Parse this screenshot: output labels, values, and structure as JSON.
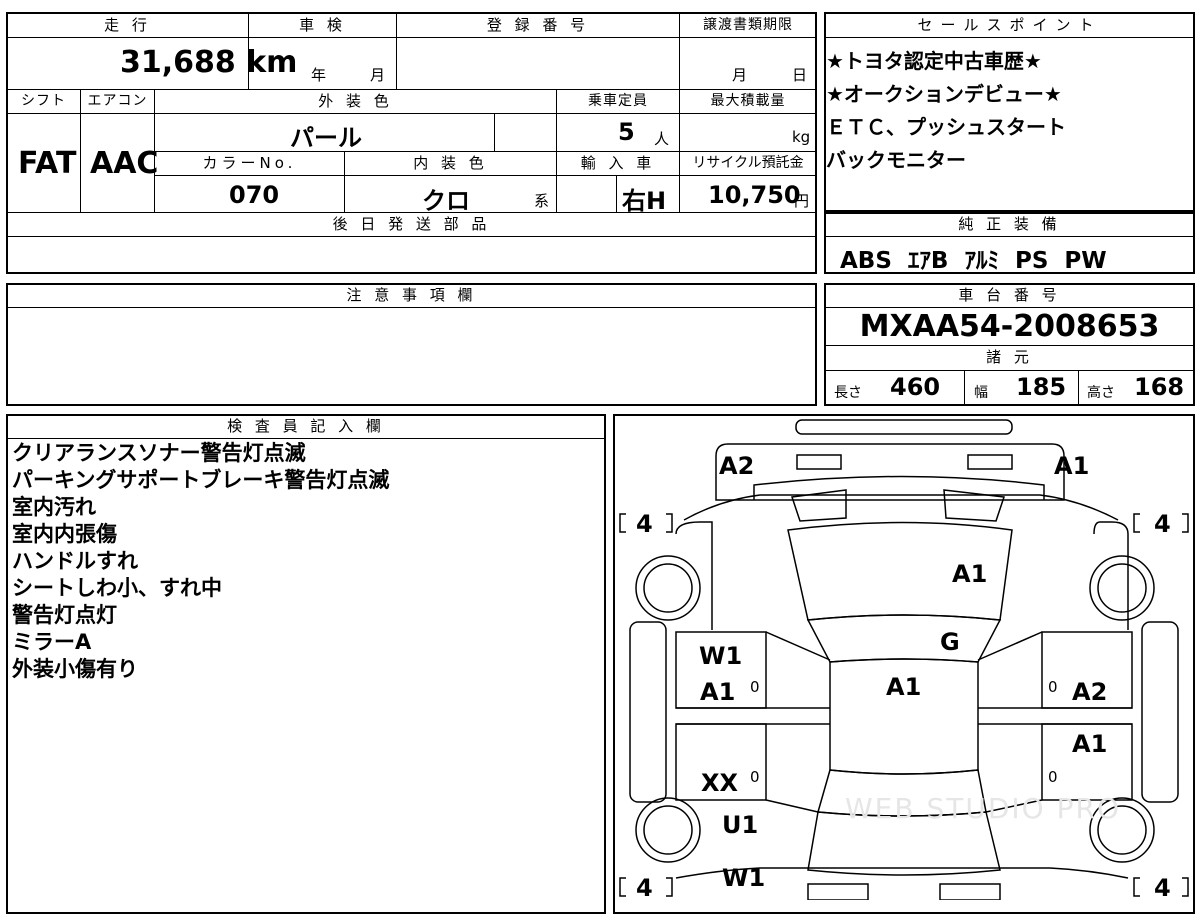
{
  "headers": {
    "mileage": "走 行",
    "inspection": "車 検",
    "registration": "登 録 番 号",
    "transfer_deadline": "譲渡書類期限",
    "sales_point": "セールスポイント",
    "shift": "シフト",
    "aircon": "エアコン",
    "exterior_color": "外 装 色",
    "capacity": "乗車定員",
    "max_load": "最大積載量",
    "color_no": "カラーNo.",
    "interior_color": "内 装 色",
    "import": "輸 入 車",
    "recycle_fee": "リサイクル預託金",
    "later_parts": "後 日 発 送 部 品",
    "standard_equipment": "純 正 装 備",
    "notes": "注 意 事 項 欄",
    "chassis_no": "車 台 番 号",
    "specs": "諸 元",
    "inspector_notes": "検 査 員 記 入 欄"
  },
  "vehicle": {
    "mileage": "31,688",
    "mileage_unit": "km",
    "inspection_year_label": "年",
    "inspection_month_label": "月",
    "transfer_month_label": "月",
    "transfer_day_label": "日",
    "shift": "FAT",
    "aircon": "AAC",
    "exterior_color": "パール",
    "capacity": "5",
    "capacity_unit": "人",
    "max_load_unit": "kg",
    "color_no": "070",
    "interior_color": "クロ",
    "interior_suffix": "系",
    "import_value": "右H",
    "recycle_fee": "10,750",
    "recycle_unit": "円",
    "chassis_no": "MXAA54-2008653",
    "specs": {
      "length_label": "長さ",
      "length": "460",
      "width_label": "幅",
      "width": "185",
      "height_label": "高さ",
      "height": "168"
    }
  },
  "sales_points": [
    "★トヨタ認定中古車歴★",
    "★オークションデビュー★",
    "ＥＴＣ、プッシュスタート",
    "バックモニター"
  ],
  "standard_equipment": [
    "ABS",
    "ｴｱB",
    "ｱﾙﾐ",
    "PS",
    "PW"
  ],
  "inspector_notes": [
    "クリアランスソナー警告灯点滅",
    "パーキングサポートブレーキ警告灯点滅",
    "室内汚れ",
    "室内内張傷",
    "ハンドルすれ",
    "シートしわ小、すれ中",
    "警告灯点灯",
    "ミラーA",
    "外装小傷有り"
  ],
  "diagram_marks": {
    "front_left": "A2",
    "front_right": "A1",
    "hood": "A1",
    "windshield": "G",
    "roof": "A1",
    "left_front_door_1": "W1",
    "left_front_door_2": "A1",
    "left_rear_door": "XX",
    "left_rear_quarter": "U1",
    "rear_left": "W1",
    "right_front_door": "A2",
    "right_rear_door": "A1",
    "tire_tl": "4",
    "tire_tr": "4",
    "tire_bl": "4",
    "tire_br": "4",
    "zero_marks": [
      "0",
      "0",
      "0",
      "0"
    ]
  },
  "watermark": "WEB STUDIO PRO"
}
